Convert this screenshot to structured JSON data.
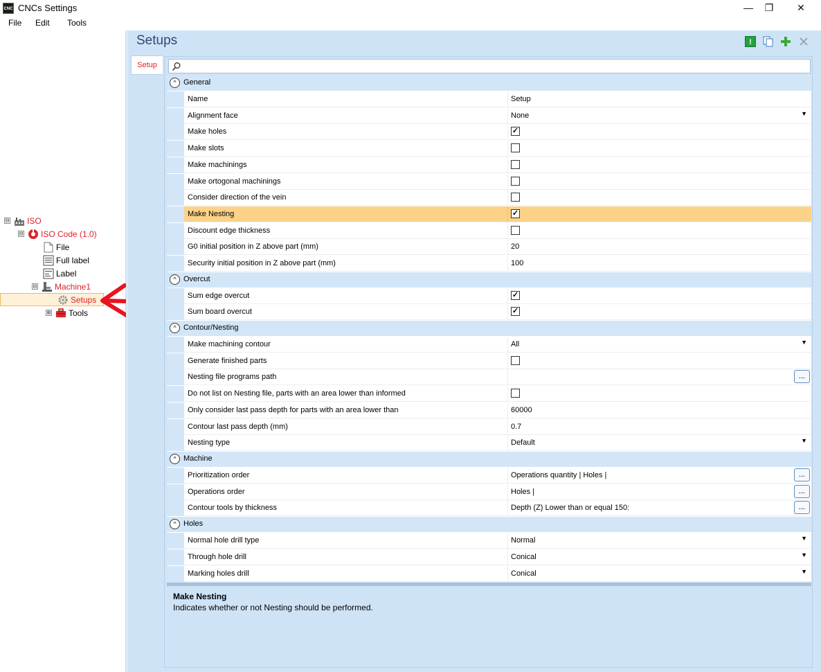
{
  "window": {
    "title": "CNCs Settings",
    "icon_text": "CNC",
    "controls": {
      "minimize": "—",
      "maximize": "❐",
      "close": "✕"
    }
  },
  "menu": [
    "File",
    "Edit",
    "Tools"
  ],
  "tree": {
    "nodes": [
      {
        "label": "ISO",
        "expander": "⊟",
        "icon": "factory-icon",
        "color": "#e0202a"
      },
      {
        "label": "ISO Code (1.0)",
        "expander": "⊟",
        "icon": "iso-code-icon",
        "color": "#e0202a"
      },
      {
        "label": "File",
        "icon": "file-icon"
      },
      {
        "label": "Full label",
        "icon": "full-label-icon"
      },
      {
        "label": "Label",
        "icon": "label-icon"
      },
      {
        "label": "Machine1",
        "expander": "⊟",
        "icon": "machine-icon",
        "color": "#e0202a"
      },
      {
        "label": "Setups",
        "icon": "gear-icon",
        "color": "#e0202a",
        "selected": true
      },
      {
        "label": "Tools",
        "expander": "⊞",
        "icon": "toolbox-icon"
      }
    ]
  },
  "main": {
    "title": "Setups",
    "toolbar_icons": [
      "info-icon",
      "copy-icon",
      "add-icon",
      "delete-icon"
    ],
    "tab": "Setup",
    "search": {
      "value": "",
      "icon": "search-icon"
    },
    "categories": [
      {
        "label": "General",
        "rows": [
          {
            "name": "Name",
            "type": "text",
            "value": "Setup"
          },
          {
            "name": "Alignment face",
            "type": "dropdown",
            "value": "None"
          },
          {
            "name": "Make holes",
            "type": "check",
            "checked": true
          },
          {
            "name": "Make slots",
            "type": "check",
            "checked": false
          },
          {
            "name": "Make machinings",
            "type": "check",
            "checked": false
          },
          {
            "name": "Make ortogonal machinings",
            "type": "check",
            "checked": false
          },
          {
            "name": "Consider direction of the vein",
            "type": "check",
            "checked": false
          },
          {
            "name": "Make Nesting",
            "type": "check",
            "checked": true,
            "selected": true
          },
          {
            "name": "Discount edge thickness",
            "type": "check",
            "checked": false
          },
          {
            "name": "G0 initial position in Z above part (mm)",
            "type": "text",
            "value": "20"
          },
          {
            "name": "Security initial position in Z above part (mm)",
            "type": "text",
            "value": "100"
          }
        ]
      },
      {
        "label": "Overcut",
        "rows": [
          {
            "name": "Sum edge overcut",
            "type": "check",
            "checked": true
          },
          {
            "name": "Sum board overcut",
            "type": "check",
            "checked": true
          }
        ]
      },
      {
        "label": "Contour/Nesting",
        "rows": [
          {
            "name": "Make machining contour",
            "type": "dropdown",
            "value": "All"
          },
          {
            "name": "Generate finished parts",
            "type": "check",
            "checked": false
          },
          {
            "name": "Nesting file programs path",
            "type": "ellipsis",
            "value": ""
          },
          {
            "name": "Do not list on Nesting file, parts with an area lower than informed",
            "type": "check",
            "checked": false
          },
          {
            "name": "Only consider last pass depth for parts with an area lower than",
            "type": "text",
            "value": "60000"
          },
          {
            "name": "Contour last pass depth (mm)",
            "type": "text",
            "value": "0.7"
          },
          {
            "name": "Nesting type",
            "type": "dropdown",
            "value": "Default"
          }
        ]
      },
      {
        "label": "Machine",
        "rows": [
          {
            "name": "Prioritization order",
            "type": "ellipsis",
            "value": "Operations quantity | Holes |"
          },
          {
            "name": "Operations order",
            "type": "ellipsis",
            "value": "Holes |"
          },
          {
            "name": "Contour tools by thickness",
            "type": "ellipsis",
            "value": "Depth (Z) Lower than or equal 150:"
          }
        ]
      },
      {
        "label": "Holes",
        "rows": [
          {
            "name": "Normal hole drill type",
            "type": "dropdown",
            "value": "Normal"
          },
          {
            "name": "Through hole drill",
            "type": "dropdown",
            "value": "Conical"
          },
          {
            "name": "Marking holes drill",
            "type": "dropdown",
            "value": "Conical"
          }
        ]
      }
    ],
    "description": {
      "title": "Make Nesting",
      "text": "Indicates whether or not Nesting should be performed."
    },
    "glyphs": {
      "collapse": "^",
      "dropdown": "▼",
      "ellipsis": "...",
      "check": "✓"
    }
  },
  "colors": {
    "accent_red": "#e0202a",
    "panel_blue": "#cfe3f7",
    "selection": "#fbd288"
  }
}
